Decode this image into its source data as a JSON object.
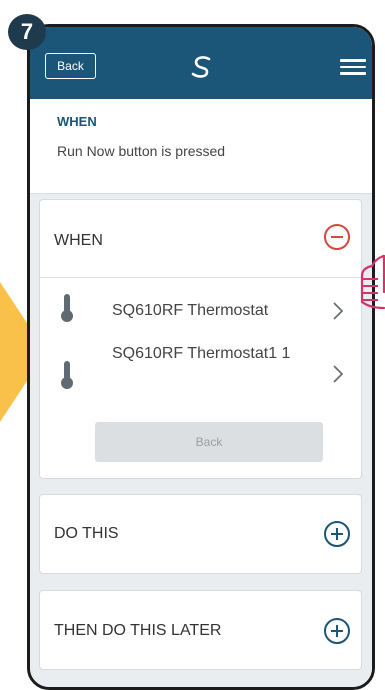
{
  "step": {
    "number": "7"
  },
  "header": {
    "back_label": "Back",
    "logo_icon": "salus-logo-icon",
    "menu_icon": "hamburger-menu-icon"
  },
  "summary": {
    "title": "WHEN",
    "description": "Run Now button is pressed"
  },
  "when_card": {
    "title": "WHEN",
    "remove_icon": "minus-circle-icon",
    "devices": [
      {
        "name": "SQ610RF Thermostat",
        "icon": "thermometer-icon"
      },
      {
        "name": "SQ610RF Thermostat1 1",
        "icon": "thermometer-icon"
      }
    ],
    "back_label": "Back"
  },
  "do_card": {
    "title": "DO THIS",
    "add_icon": "plus-circle-icon"
  },
  "later_card": {
    "title": "THEN DO THIS LATER",
    "add_icon": "plus-circle-icon"
  },
  "colors": {
    "header": "#1b5578",
    "accent": "#1b5578",
    "remove": "#d14a3a",
    "highlight": "#f9c14a",
    "hand": "#d6336c"
  }
}
